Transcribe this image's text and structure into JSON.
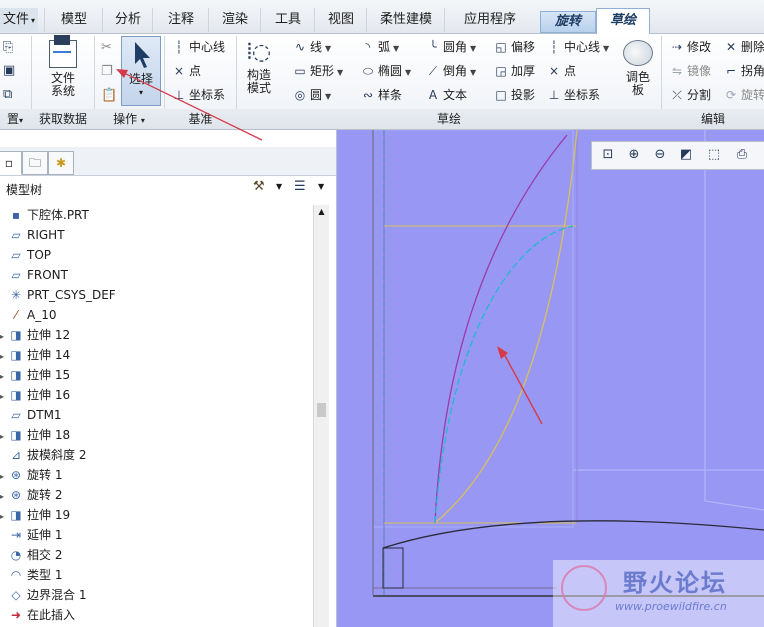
{
  "tabs": [
    {
      "label": "文件",
      "dropdown": true
    },
    {
      "label": "模型"
    },
    {
      "label": "分析"
    },
    {
      "label": "注释"
    },
    {
      "label": "渲染"
    },
    {
      "label": "工具"
    },
    {
      "label": "视图"
    },
    {
      "label": "柔性建模"
    },
    {
      "label": "应用程序"
    },
    {
      "label": "旋转",
      "context": true
    },
    {
      "label": "草绘",
      "active": true
    }
  ],
  "ribbon": {
    "file_system": "文件\n系统",
    "select": "选择",
    "construct_mode": "构造\n模式",
    "palette": "调色\n板",
    "datum_cmds": [
      "中心线",
      "点",
      "坐标系"
    ],
    "sketch_col1": [
      "线",
      "矩形",
      "圆"
    ],
    "sketch_col2": [
      "弧",
      "椭圆",
      "样条"
    ],
    "sketch_col3": [
      "圆角",
      "倒角",
      "文本"
    ],
    "sketch_col4": [
      "偏移",
      "加厚",
      "投影"
    ],
    "sketch_col5": [
      "中心线",
      "点",
      "坐标系"
    ],
    "edit_col1": [
      "修改",
      "镜像",
      "分割"
    ],
    "edit_col2": [
      "删除",
      "拐角",
      "旋转"
    ]
  },
  "groups": {
    "setup": "置",
    "get_data": "获取数据",
    "operations": "操作",
    "datum": "基准",
    "sketch": "草绘",
    "edit": "编辑"
  },
  "model_tree": {
    "title": "模型树",
    "items": [
      {
        "label": "下腔体.PRT",
        "icon": "part-icon"
      },
      {
        "label": "RIGHT",
        "icon": "datum-plane-icon"
      },
      {
        "label": "TOP",
        "icon": "datum-plane-icon"
      },
      {
        "label": "FRONT",
        "icon": "datum-plane-icon"
      },
      {
        "label": "PRT_CSYS_DEF",
        "icon": "csys-icon"
      },
      {
        "label": "A_10",
        "icon": "datum-axis-icon"
      },
      {
        "label": "拉伸 12",
        "icon": "extrude-icon",
        "expandable": true
      },
      {
        "label": "拉伸 14",
        "icon": "extrude-icon",
        "expandable": true
      },
      {
        "label": "拉伸 15",
        "icon": "extrude-icon",
        "expandable": true
      },
      {
        "label": "拉伸 16",
        "icon": "extrude-icon",
        "expandable": true
      },
      {
        "label": "DTM1",
        "icon": "datum-plane-icon"
      },
      {
        "label": "拉伸 18",
        "icon": "extrude-icon",
        "expandable": true
      },
      {
        "label": "拔模斜度 2",
        "icon": "draft-icon"
      },
      {
        "label": "旋转 1",
        "icon": "revolve-icon",
        "expandable": true
      },
      {
        "label": "旋转 2",
        "icon": "revolve-icon",
        "expandable": true
      },
      {
        "label": "拉伸 19",
        "icon": "extrude-icon",
        "expandable": true
      },
      {
        "label": "延伸 1",
        "icon": "extend-icon"
      },
      {
        "label": "相交 2",
        "icon": "intersect-icon"
      },
      {
        "label": "类型 1",
        "icon": "type-icon"
      },
      {
        "label": "边界混合 1",
        "icon": "boundary-blend-icon"
      },
      {
        "label": "在此插入",
        "icon": "insert-here-icon"
      }
    ]
  },
  "watermark": {
    "name": "野火论坛",
    "url": "www.proewildfire.cn"
  },
  "colors": {
    "canvas": "#9898f4",
    "accent": "#1f3e66",
    "arrow": "#d63a4a"
  }
}
